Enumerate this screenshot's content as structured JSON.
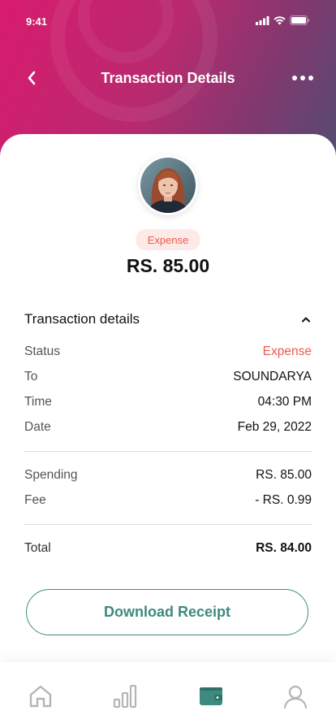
{
  "status_bar": {
    "time": "9:41"
  },
  "header": {
    "title": "Transaction Details"
  },
  "transaction": {
    "type_badge": "Expense",
    "amount": "RS. 85.00"
  },
  "details": {
    "section_title": "Transaction details",
    "rows": [
      {
        "label": "Status",
        "value": "Expense"
      },
      {
        "label": "To",
        "value": "SOUNDARYA"
      },
      {
        "label": "Time",
        "value": "04:30 PM"
      },
      {
        "label": "Date",
        "value": "Feb 29, 2022"
      }
    ],
    "costs": [
      {
        "label": "Spending",
        "value": "RS. 85.00"
      },
      {
        "label": "Fee",
        "value": "- RS. 0.99"
      }
    ],
    "total": {
      "label": "Total",
      "value": "RS. 84.00"
    }
  },
  "actions": {
    "download_label": "Download Receipt"
  },
  "bottom_nav": {
    "items": [
      {
        "icon": "home-icon",
        "active": false
      },
      {
        "icon": "stats-icon",
        "active": false
      },
      {
        "icon": "wallet-icon",
        "active": true
      },
      {
        "icon": "profile-icon",
        "active": false
      }
    ]
  },
  "colors": {
    "accent": "#3d8a80",
    "expense": "#ec5b4d",
    "header_gradient_start": "#d81b6e",
    "header_gradient_end": "#4f4f72"
  }
}
